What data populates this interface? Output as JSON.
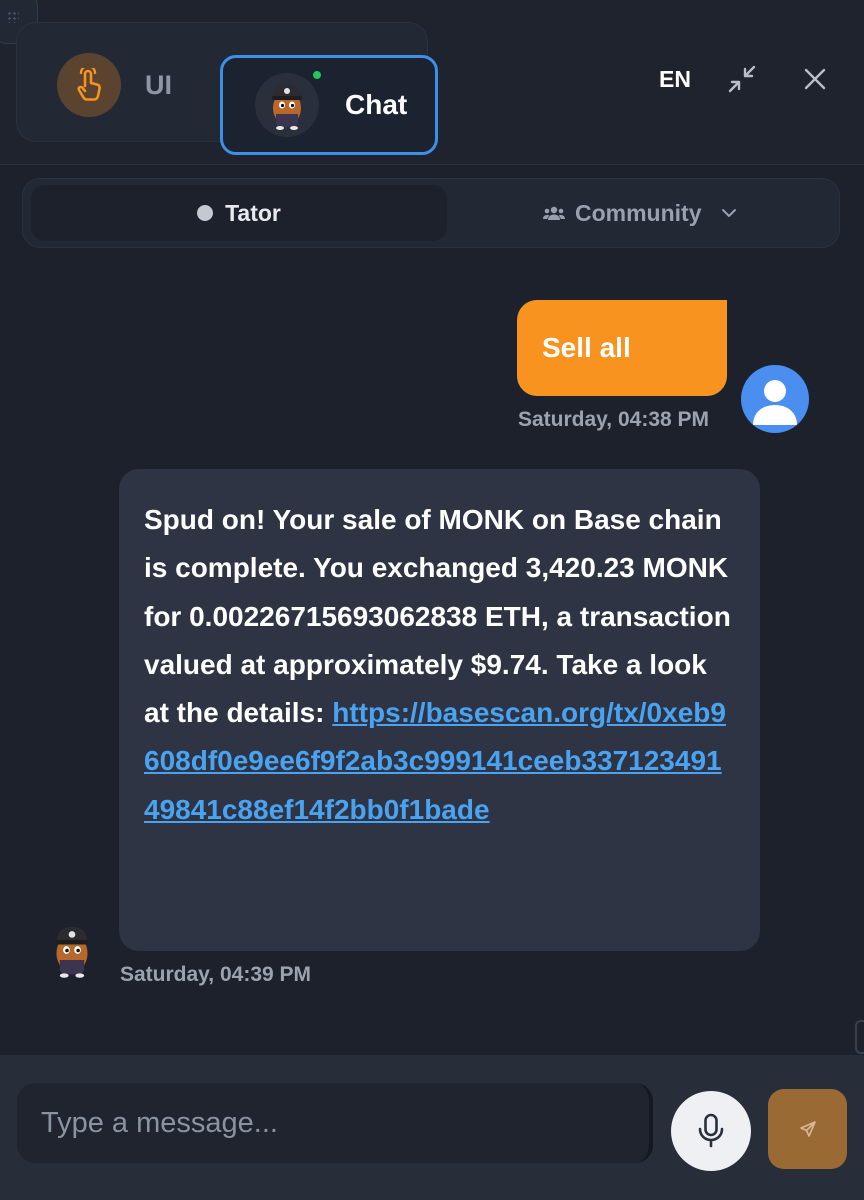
{
  "header": {
    "mode_ui_label": "UI",
    "mode_chat_label": "Chat",
    "language": "EN"
  },
  "tabs": {
    "tator_label": "Tator",
    "community_label": "Community"
  },
  "messages": {
    "user": {
      "text": "Sell all",
      "timestamp": "Saturday, 04:38 PM"
    },
    "bot": {
      "text": "Spud on! Your sale of MONK on Base chain is complete. You exchanged 3,420.23 MONK for 0.00226715693062838 ETH, a transaction valued at approximately $9.74. Take a look at the details: ",
      "link": "https://basescan.org/tx/0xeb9608df0e9ee6f9f2ab3c999141ceeb33712349149841c88ef14f2bb0f1bade",
      "timestamp": "Saturday, 04:39 PM"
    }
  },
  "composer": {
    "placeholder": "Type a message..."
  },
  "colors": {
    "background": "#1c212b",
    "accent_orange": "#f7931e",
    "accent_blue": "#3f8ee8",
    "link": "#4aa3f0",
    "online": "#22c55e"
  },
  "icons": {
    "ui_mode": "pointer-hand-icon",
    "minimize": "minimize-arrows-icon",
    "close": "close-icon",
    "community": "users-icon",
    "dropdown": "chevron-down-icon",
    "mic": "microphone-icon",
    "send": "send-icon"
  }
}
